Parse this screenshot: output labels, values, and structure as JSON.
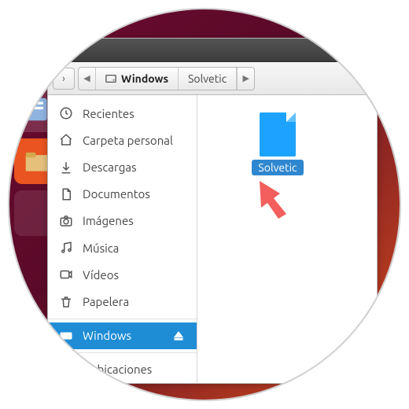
{
  "breadcrumb": {
    "windows": "Windows",
    "solvetic": "Solvetic"
  },
  "sidebar": {
    "recent": "Recientes",
    "home": "Carpeta personal",
    "downloads": "Descargas",
    "documents": "Documentos",
    "pictures": "Imágenes",
    "music": "Música",
    "videos": "Vídeos",
    "trash": "Papelera",
    "windows_drive": "Windows",
    "other": "s ubicaciones"
  },
  "file": {
    "name": "Solvetic"
  },
  "colors": {
    "selection": "#1f8dd6",
    "file_blue": "#1da3ff",
    "arrow": "#f25f5c"
  }
}
